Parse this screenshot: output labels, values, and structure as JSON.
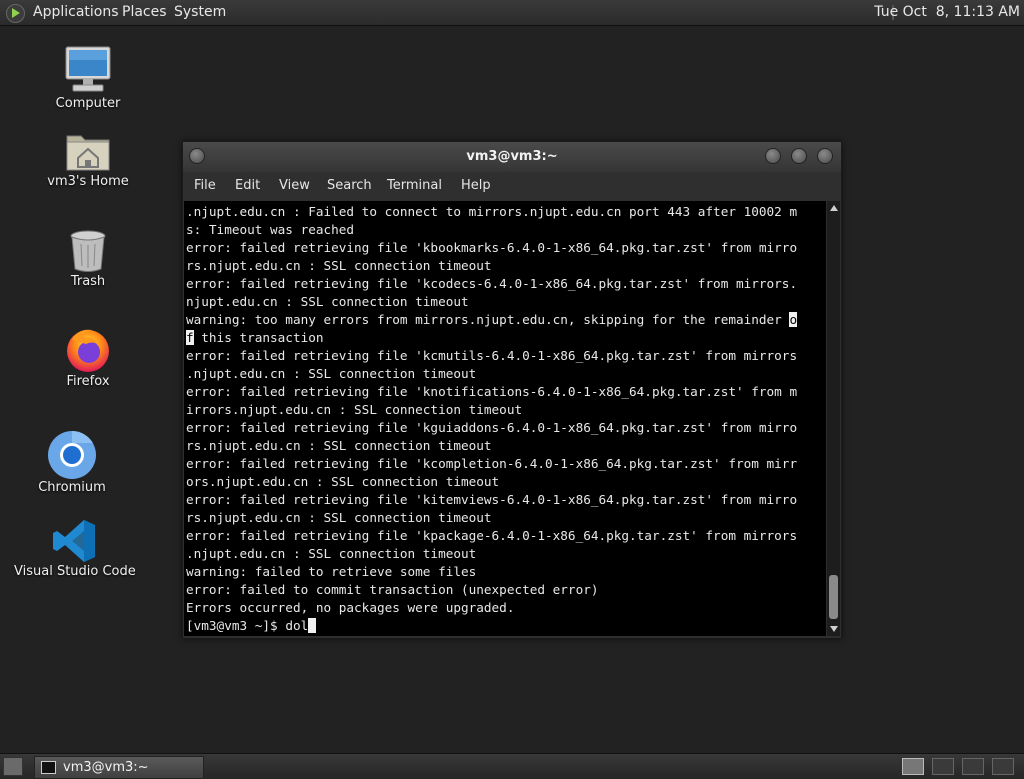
{
  "top_panel": {
    "menus": [
      "Applications",
      "Places",
      "System"
    ],
    "clock": "Tue Oct  8, 11:13 AM"
  },
  "desktop_icons": [
    {
      "label": "Computer",
      "icon": "computer-icon"
    },
    {
      "label": "vm3's Home",
      "icon": "home-folder-icon"
    },
    {
      "label": "Trash",
      "icon": "trash-icon"
    },
    {
      "label": "Firefox",
      "icon": "firefox-icon"
    },
    {
      "label": "Chromium",
      "icon": "chromium-icon"
    },
    {
      "label": "Visual Studio Code",
      "icon": "vscode-icon"
    }
  ],
  "terminal": {
    "title": "vm3@vm3:~",
    "menu": [
      "File",
      "Edit",
      "View",
      "Search",
      "Terminal",
      "Help"
    ],
    "lines_before_cursor": [
      ".njupt.edu.cn : Failed to connect to mirrors.njupt.edu.cn port 443 after 10002 m",
      "s: Timeout was reached",
      "error: failed retrieving file 'kbookmarks-6.4.0-1-x86_64.pkg.tar.zst' from mirro",
      "rs.njupt.edu.cn : SSL connection timeout",
      "error: failed retrieving file 'kcodecs-6.4.0-1-x86_64.pkg.tar.zst' from mirrors.",
      "njupt.edu.cn : SSL connection timeout"
    ],
    "warning_line_start": "warning: too many errors from mirrors.njupt.edu.cn, skipping for the remainder ",
    "warning_line_char": "o",
    "warning_cont_char": "f",
    "warning_cont_rest": " this transaction",
    "lines_after": [
      "error: failed retrieving file 'kcmutils-6.4.0-1-x86_64.pkg.tar.zst' from mirrors",
      ".njupt.edu.cn : SSL connection timeout",
      "error: failed retrieving file 'knotifications-6.4.0-1-x86_64.pkg.tar.zst' from m",
      "irrors.njupt.edu.cn : SSL connection timeout",
      "error: failed retrieving file 'kguiaddons-6.4.0-1-x86_64.pkg.tar.zst' from mirro",
      "rs.njupt.edu.cn : SSL connection timeout",
      "error: failed retrieving file 'kcompletion-6.4.0-1-x86_64.pkg.tar.zst' from mirr",
      "ors.njupt.edu.cn : SSL connection timeout",
      "error: failed retrieving file 'kitemviews-6.4.0-1-x86_64.pkg.tar.zst' from mirro",
      "rs.njupt.edu.cn : SSL connection timeout",
      "error: failed retrieving file 'kpackage-6.4.0-1-x86_64.pkg.tar.zst' from mirrors",
      ".njupt.edu.cn : SSL connection timeout",
      "warning: failed to retrieve some files",
      "error: failed to commit transaction (unexpected error)",
      "Errors occurred, no packages were upgraded."
    ],
    "prompt": "[vm3@vm3 ~]$ ",
    "input": "dol"
  },
  "taskbar": {
    "task_label": "vm3@vm3:~"
  }
}
